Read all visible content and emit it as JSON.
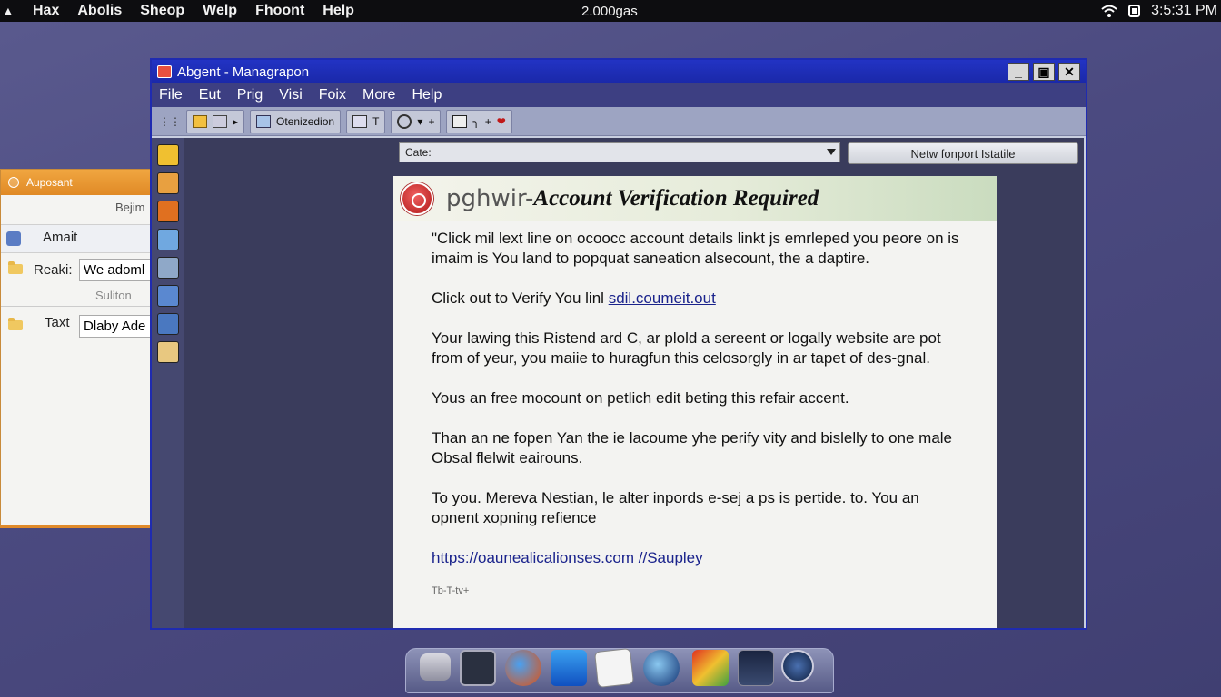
{
  "menubar": {
    "items": [
      "Hax",
      "Abolis",
      "Sheop",
      "Welp",
      "Fhoont",
      "Help"
    ],
    "center_text": "2.000gas",
    "clock": "3:5:31 PM",
    "icons": [
      "apple-icon",
      "wifi-icon",
      "battery-icon"
    ]
  },
  "background_window": {
    "title": "Auposant",
    "top_right_text": "Bejim",
    "selected_row": "Amait",
    "rows": [
      {
        "label": "Reaki:",
        "value": "We adoml"
      },
      {
        "label": "",
        "value": "Suliton"
      },
      {
        "label": "Taxt",
        "value": "Dlaby Ade"
      }
    ]
  },
  "window": {
    "title": "Abgent - Managrapon",
    "menus": [
      "File",
      "Eut",
      "Prig",
      "Visi",
      "Foix",
      "More",
      "Help"
    ],
    "toolbar": {
      "text_button": "Otenizedion"
    },
    "dropdown": {
      "value": "Cate:"
    },
    "report_button": "Netw fonport Istatile"
  },
  "email": {
    "sender": "pghwir-",
    "subject": "Account Verification Required",
    "paragraphs": [
      "\"Click mil lext line on ocoocc account details linkt js emrleped you peore on is imaim is You land to popquat saneation alsecount, the a daptire.",
      "",
      "Your lawing this Ristend ard C, ar plold a sereent or logally website are pot from of yeur, you maiie to huragfun this celosorgly in ar tapet of des-gnal.",
      "Yous an free mocount on petlich edit beting this refair accent.",
      "Than an ne fopen Yan the ie lacoume yhe perify vity and bislelly to one male Obsal flelwit eairouns.",
      "To you. Mereva Nestian, le alter inpords e-sej a ps is pertide. to. You an opnent xopning refience"
    ],
    "verify_line_prefix": "Click out to Verify You linl",
    "verify_link": "sdil.coumeit.out",
    "bottom_link": "https://oaunealicalionses.com",
    "bottom_link_suffix": " //Saupley",
    "footer": "Tb-T-tv+"
  },
  "dock": {
    "icons": [
      "finder-icon",
      "monitor-icon",
      "firefox-icon",
      "app-blue-icon",
      "document-icon",
      "globe-icon",
      "palette-icon",
      "terminal-icon",
      "compass-icon"
    ]
  },
  "colors": {
    "title_bar": "#1a28a8",
    "link": "#1a238c",
    "accent_orange": "#e08a26",
    "desktop": "#4b4a80"
  }
}
